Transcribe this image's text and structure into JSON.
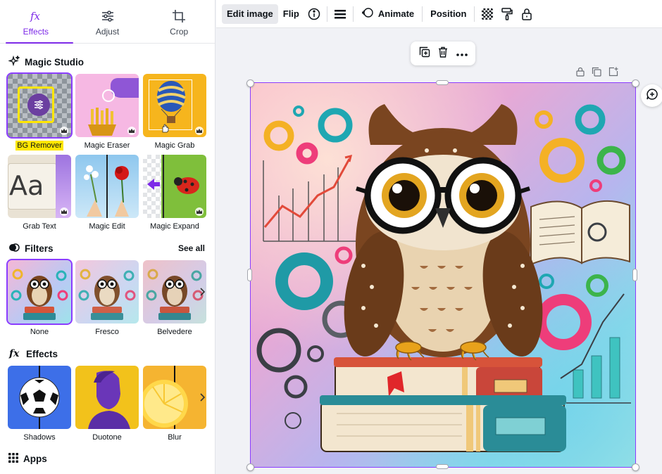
{
  "tabs": [
    {
      "label": "Effects",
      "icon": "fx-icon",
      "active": true
    },
    {
      "label": "Adjust",
      "icon": "sliders-icon"
    },
    {
      "label": "Crop",
      "icon": "crop-icon"
    }
  ],
  "magic_studio": {
    "title": "Magic Studio",
    "icon": "sparkles-icon",
    "tools": [
      {
        "label": "BG Remover",
        "premium": true,
        "selected": true
      },
      {
        "label": "Magic Eraser",
        "premium": true
      },
      {
        "label": "Magic Grab",
        "premium": true
      },
      {
        "label": "Grab Text",
        "premium": true
      },
      {
        "label": "Magic Edit",
        "premium": false
      },
      {
        "label": "Magic Expand",
        "premium": true
      }
    ]
  },
  "filters": {
    "title": "Filters",
    "see_all": "See all",
    "items": [
      {
        "label": "None",
        "selected": true
      },
      {
        "label": "Fresco"
      },
      {
        "label": "Belvedere"
      }
    ]
  },
  "effects": {
    "title": "Effects",
    "items": [
      {
        "label": "Shadows"
      },
      {
        "label": "Duotone"
      },
      {
        "label": "Blur"
      }
    ]
  },
  "apps": {
    "title": "Apps",
    "icon": "grid-icon"
  },
  "toolbar": {
    "edit_image": "Edit image",
    "flip": "Flip",
    "animate": "Animate",
    "position": "Position"
  },
  "colors": {
    "accent": "#7d2ae8",
    "selection": "#8b3dff",
    "highlight": "#ffe600"
  }
}
